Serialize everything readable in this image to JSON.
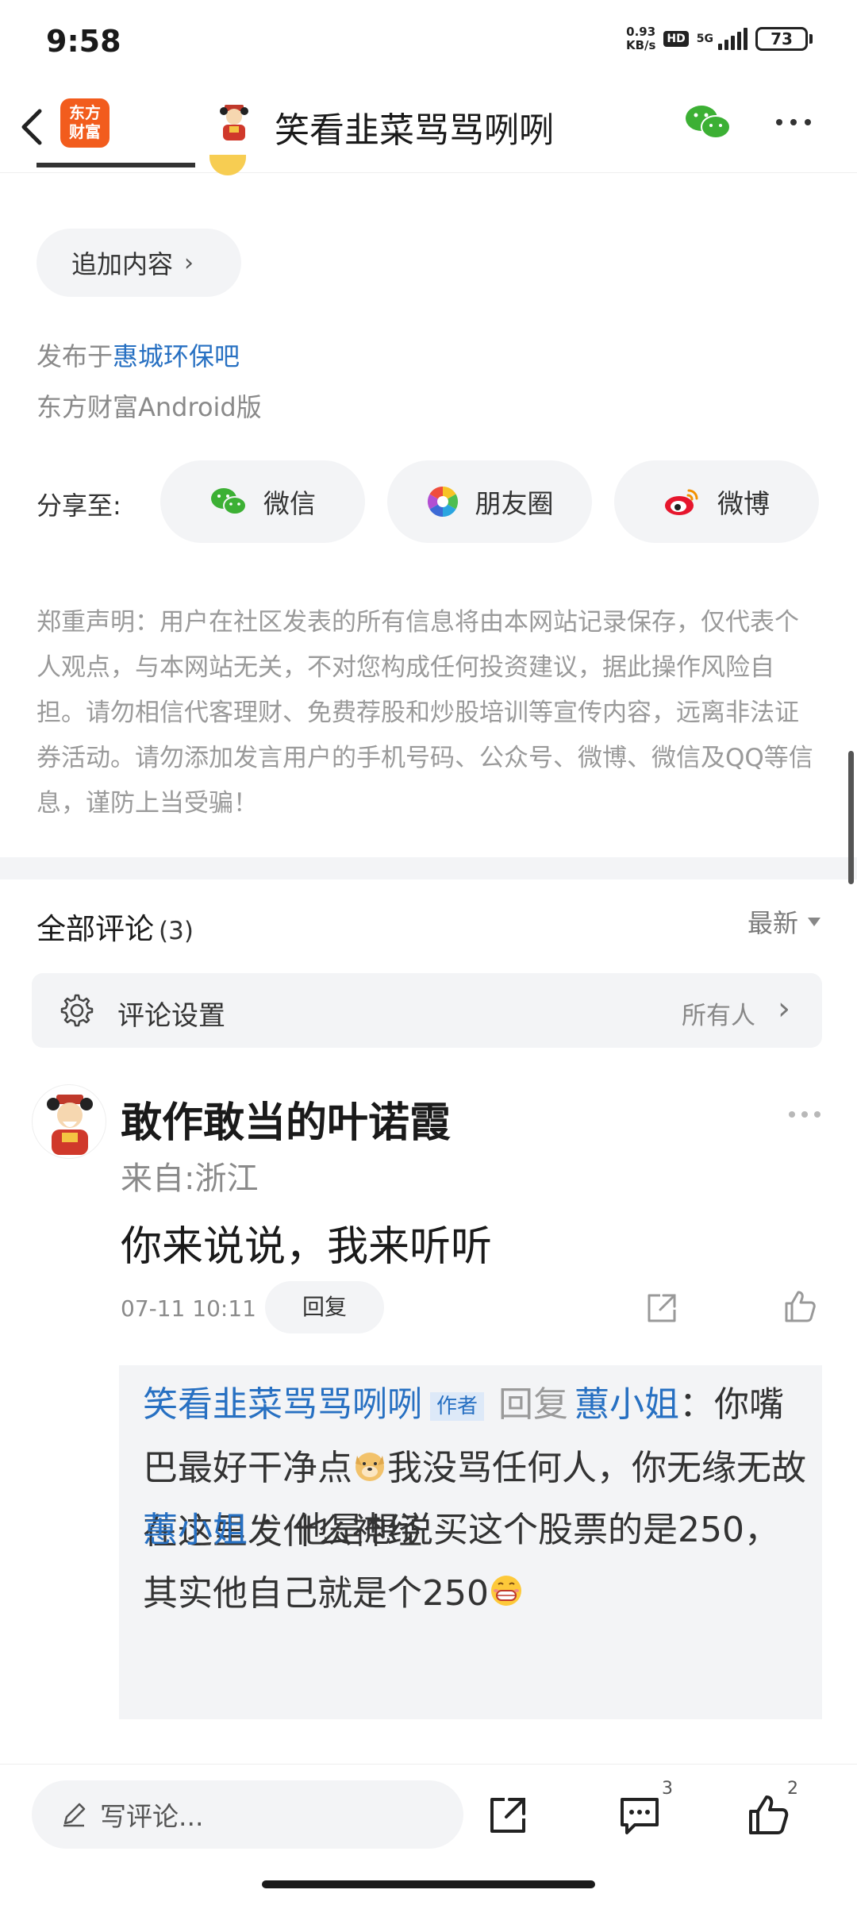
{
  "status_bar": {
    "time": "9:58",
    "net_speed_value": "0.93",
    "net_speed_unit": "KB/s",
    "hd": "HD",
    "network": "5G",
    "battery": "73"
  },
  "header": {
    "logo_line1": "东方",
    "logo_line2": "财富",
    "title": "笑看韭菜骂骂咧咧"
  },
  "post": {
    "add_content_label": "追加内容",
    "published_prefix": "发布于",
    "published_bar": "惠城环保吧",
    "platform": "东方财富Android版",
    "share_label": "分享至:",
    "share_options": [
      {
        "label": "微信",
        "icon": "wechat-icon"
      },
      {
        "label": "朋友圈",
        "icon": "moments-icon"
      },
      {
        "label": "微博",
        "icon": "weibo-icon"
      }
    ],
    "disclaimer": "郑重声明：用户在社区发表的所有信息将由本网站记录保存，仅代表个人观点，与本网站无关，不对您构成任何投资建议，据此操作风险自担。请勿相信代客理财、免费荐股和炒股培训等宣传内容，远离非法证券活动。请勿添加发言用户的手机号码、公众号、微博、微信及QQ等信息，谨防上当受骗！"
  },
  "comments": {
    "title": "全部评论",
    "count": "(3)",
    "sort": "最新",
    "settings_label": "评论设置",
    "settings_value": "所有人",
    "items": [
      {
        "author": "敢作敢当的叶诺霞",
        "location": "来自:浙江",
        "text": "你来说说，我来听听",
        "time": "07-11 10:11",
        "reply_label": "回复",
        "replies": [
          {
            "from": "笑看韭菜骂骂咧咧",
            "badge": "作者",
            "reply_word": "回复",
            "to": "蕙小姐",
            "text_part1": "你嘴巴最好干净点",
            "text_part2": "我没骂任何人，你无缘无故在这里发什么神经"
          },
          {
            "from": "蕙小姐",
            "text": "他是想说买这个股票的是250，其实他自己就是个250"
          }
        ]
      }
    ]
  },
  "bottom_bar": {
    "input_placeholder": "写评论...",
    "comment_count": "3",
    "like_count": "2"
  },
  "colors": {
    "accent_blue": "#2770c2",
    "brand_orange": "#f25c1d",
    "wechat_green": "#3cb034"
  }
}
